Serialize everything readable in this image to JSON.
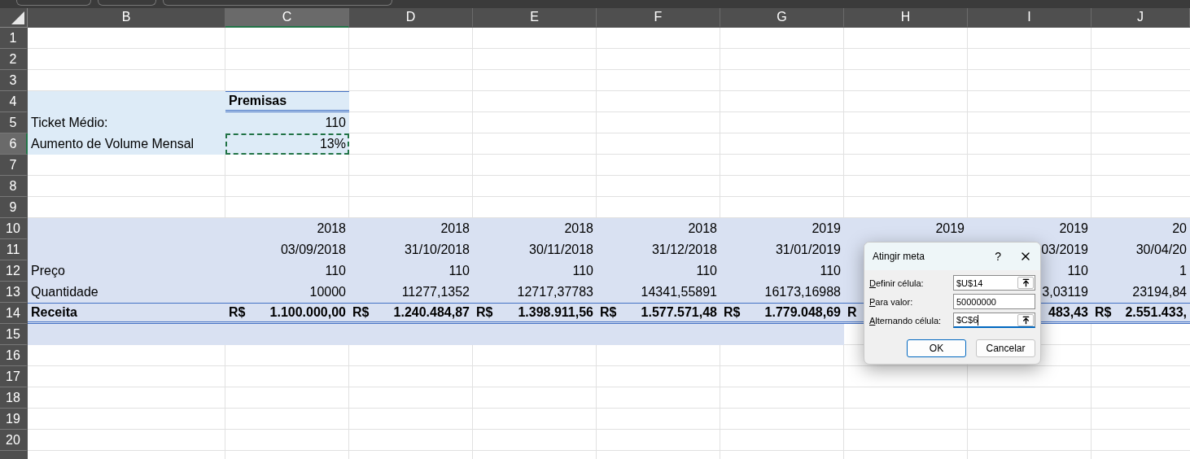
{
  "columns": [
    {
      "label": "B",
      "selected": false
    },
    {
      "label": "C",
      "selected": true
    },
    {
      "label": "D",
      "selected": false
    },
    {
      "label": "E",
      "selected": false
    },
    {
      "label": "F",
      "selected": false
    },
    {
      "label": "G",
      "selected": false
    },
    {
      "label": "H",
      "selected": false
    },
    {
      "label": "I",
      "selected": false
    },
    {
      "label": "J",
      "selected": false
    }
  ],
  "rows": [
    {
      "label": "1",
      "selected": false,
      "total": false
    },
    {
      "label": "2",
      "selected": false,
      "total": false
    },
    {
      "label": "3",
      "selected": false,
      "total": false
    },
    {
      "label": "4",
      "selected": false,
      "total": false,
      "cells": [
        {
          "kind": "blank",
          "color": "#ddebf7"
        },
        {
          "kind": "heading",
          "text": "Premisas",
          "color": "#ddebf7"
        }
      ]
    },
    {
      "label": "5",
      "selected": false,
      "total": false,
      "cells": [
        {
          "kind": "text",
          "text": "Ticket Médio:",
          "color": "#ddebf7"
        },
        {
          "kind": "number",
          "text": "110",
          "color": "#ddebf7"
        }
      ]
    },
    {
      "label": "6",
      "selected": true,
      "total": false,
      "cells": [
        {
          "kind": "text",
          "text": "Aumento de Volume Mensal",
          "color": "#ddebf7"
        },
        {
          "kind": "number",
          "text": "13%",
          "color": "#ddebf7",
          "marquee": true
        }
      ]
    },
    {
      "label": "7",
      "selected": false,
      "total": false
    },
    {
      "label": "8",
      "selected": false,
      "total": false
    },
    {
      "label": "9",
      "selected": false,
      "total": false
    },
    {
      "label": "10",
      "selected": false,
      "total": false,
      "cells": [
        {
          "kind": "blank",
          "color": "#d9e1f2"
        },
        {
          "kind": "number",
          "text": "2018",
          "color": "#d9e1f2"
        },
        {
          "kind": "number",
          "text": "2018",
          "color": "#d9e1f2"
        },
        {
          "kind": "number",
          "text": "2018",
          "color": "#d9e1f2"
        },
        {
          "kind": "number",
          "text": "2018",
          "color": "#d9e1f2"
        },
        {
          "kind": "number",
          "text": "2019",
          "color": "#d9e1f2"
        },
        {
          "kind": "number",
          "text": "2019",
          "color": "#d9e1f2"
        },
        {
          "kind": "number",
          "text": "2019",
          "color": "#d9e1f2"
        },
        {
          "kind": "number",
          "text": "20",
          "color": "#d9e1f2"
        }
      ]
    },
    {
      "label": "11",
      "selected": false,
      "total": false,
      "cells": [
        {
          "kind": "blank",
          "color": "#d9e1f2"
        },
        {
          "kind": "number",
          "text": "03/09/2018",
          "color": "#d9e1f2"
        },
        {
          "kind": "number",
          "text": "31/10/2018",
          "color": "#d9e1f2"
        },
        {
          "kind": "number",
          "text": "30/11/2018",
          "color": "#d9e1f2"
        },
        {
          "kind": "number",
          "text": "31/12/2018",
          "color": "#d9e1f2"
        },
        {
          "kind": "number",
          "text": "31/01/2019",
          "color": "#d9e1f2"
        },
        {
          "kind": "blank",
          "color": "#d9e1f2"
        },
        {
          "kind": "number",
          "text": "03/2019",
          "color": "#d9e1f2"
        },
        {
          "kind": "number",
          "text": "30/04/20",
          "color": "#d9e1f2"
        }
      ]
    },
    {
      "label": "12",
      "selected": false,
      "total": false,
      "cells": [
        {
          "kind": "text",
          "text": "Preço",
          "color": "#d9e1f2"
        },
        {
          "kind": "number",
          "text": "110",
          "color": "#d9e1f2"
        },
        {
          "kind": "number",
          "text": "110",
          "color": "#d9e1f2"
        },
        {
          "kind": "number",
          "text": "110",
          "color": "#d9e1f2"
        },
        {
          "kind": "number",
          "text": "110",
          "color": "#d9e1f2"
        },
        {
          "kind": "number",
          "text": "110",
          "color": "#d9e1f2"
        },
        {
          "kind": "blank",
          "color": "#d9e1f2"
        },
        {
          "kind": "number",
          "text": "110",
          "color": "#d9e1f2"
        },
        {
          "kind": "number",
          "text": "1",
          "color": "#d9e1f2"
        }
      ]
    },
    {
      "label": "13",
      "selected": false,
      "total": false,
      "cells": [
        {
          "kind": "text",
          "text": "Quantidade",
          "color": "#d9e1f2"
        },
        {
          "kind": "number",
          "text": "10000",
          "color": "#d9e1f2"
        },
        {
          "kind": "number",
          "text": "11277,1352",
          "color": "#d9e1f2"
        },
        {
          "kind": "number",
          "text": "12717,37783",
          "color": "#d9e1f2"
        },
        {
          "kind": "number",
          "text": "14341,55891",
          "color": "#d9e1f2"
        },
        {
          "kind": "number",
          "text": "16173,16988",
          "color": "#d9e1f2"
        },
        {
          "kind": "blank",
          "color": "#d9e1f2"
        },
        {
          "kind": "number",
          "text": "3,03119",
          "color": "#d9e1f2"
        },
        {
          "kind": "number",
          "text": "23194,84",
          "color": "#d9e1f2"
        }
      ]
    },
    {
      "label": "14",
      "selected": false,
      "total": true,
      "cells": [
        {
          "kind": "text",
          "text": "Receita",
          "color": "#d9e1f2"
        },
        {
          "kind": "money",
          "currency": "R$",
          "amount": "1.100.000,00",
          "color": "#d9e1f2"
        },
        {
          "kind": "money",
          "currency": "R$",
          "amount": "1.240.484,87",
          "color": "#d9e1f2"
        },
        {
          "kind": "money",
          "currency": "R$",
          "amount": "1.398.911,56",
          "color": "#d9e1f2"
        },
        {
          "kind": "money",
          "currency": "R$",
          "amount": "1.577.571,48",
          "color": "#d9e1f2"
        },
        {
          "kind": "money",
          "currency": "R$",
          "amount": "1.779.048,69",
          "color": "#d9e1f2"
        },
        {
          "kind": "money",
          "currency": "R",
          "color": "#d9e1f2"
        },
        {
          "kind": "money",
          "amount": "483,43",
          "color": "#d9e1f2"
        },
        {
          "kind": "money",
          "currency": "R$",
          "amount": "2.551.433,",
          "color": "#d9e1f2"
        }
      ]
    },
    {
      "label": "15",
      "selected": false,
      "total": false,
      "cells": [
        {
          "kind": "blank",
          "color": "#d9e1f2"
        },
        {
          "kind": "blank",
          "color": "#d9e1f2"
        },
        {
          "kind": "blank",
          "color": "#d9e1f2"
        },
        {
          "kind": "blank",
          "color": "#d9e1f2"
        },
        {
          "kind": "blank",
          "color": "#d9e1f2"
        },
        {
          "kind": "blank",
          "color": "#d9e1f2"
        }
      ]
    },
    {
      "label": "16",
      "selected": false,
      "total": false
    },
    {
      "label": "17",
      "selected": false,
      "total": false
    },
    {
      "label": "18",
      "selected": false,
      "total": false
    },
    {
      "label": "19",
      "selected": false,
      "total": false
    },
    {
      "label": "20",
      "selected": false,
      "total": false
    }
  ],
  "dialog": {
    "title": "Atingir meta",
    "help": "?",
    "fields": [
      {
        "label": "Definir célula:",
        "value": "$U$14",
        "kind": "reference",
        "focused": false
      },
      {
        "label": "Para valor:",
        "value": "50000000",
        "kind": "value",
        "focused": false
      },
      {
        "label": "Alternando célula:",
        "value": "$C$6",
        "kind": "reference",
        "focused": true
      }
    ],
    "buttons": [
      {
        "label": "OK",
        "default": true
      },
      {
        "label": "Cancelar",
        "default": false
      }
    ]
  }
}
